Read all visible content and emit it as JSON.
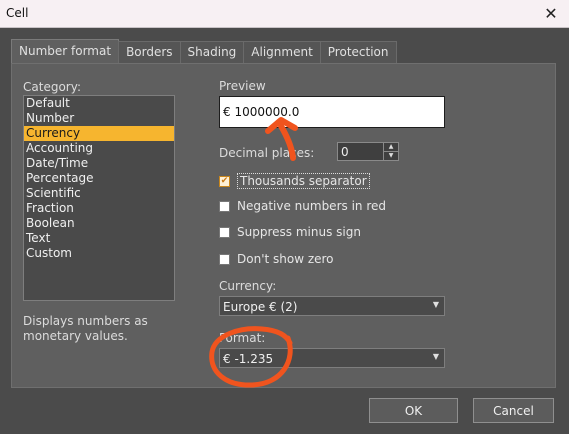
{
  "window": {
    "title": "Cell"
  },
  "tabs": [
    {
      "label": "Number format",
      "active": true
    },
    {
      "label": "Borders",
      "active": false
    },
    {
      "label": "Shading",
      "active": false
    },
    {
      "label": "Alignment",
      "active": false
    },
    {
      "label": "Protection",
      "active": false
    }
  ],
  "category": {
    "label": "Category:",
    "items": [
      "Default",
      "Number",
      "Currency",
      "Accounting",
      "Date/Time",
      "Percentage",
      "Scientific",
      "Fraction",
      "Boolean",
      "Text",
      "Custom"
    ],
    "selected": "Currency",
    "description": "Displays numbers as monetary values."
  },
  "preview": {
    "label": "Preview",
    "value": "€ 1000000.0"
  },
  "decimal_places": {
    "label": "Decimal places:",
    "value": "0"
  },
  "options": {
    "thousands_separator": {
      "label": "Thousands separator",
      "checked": true
    },
    "negative_red": {
      "label": "Negative numbers in red",
      "checked": false
    },
    "suppress_minus": {
      "label": "Suppress minus sign",
      "checked": false
    },
    "dont_show_zero": {
      "label": "Don't show zero",
      "checked": false
    }
  },
  "currency": {
    "label": "Currency:",
    "value": "Europe € (2)"
  },
  "format": {
    "label": "Format:",
    "value": "€ -1.235"
  },
  "buttons": {
    "ok": "OK",
    "cancel": "Cancel"
  },
  "colors": {
    "accent": "#f6b52f",
    "annotation": "#f0541e"
  },
  "icons": {
    "close": "close-icon",
    "check": "checkmark-icon",
    "dropdown": "chevron-down-icon"
  }
}
